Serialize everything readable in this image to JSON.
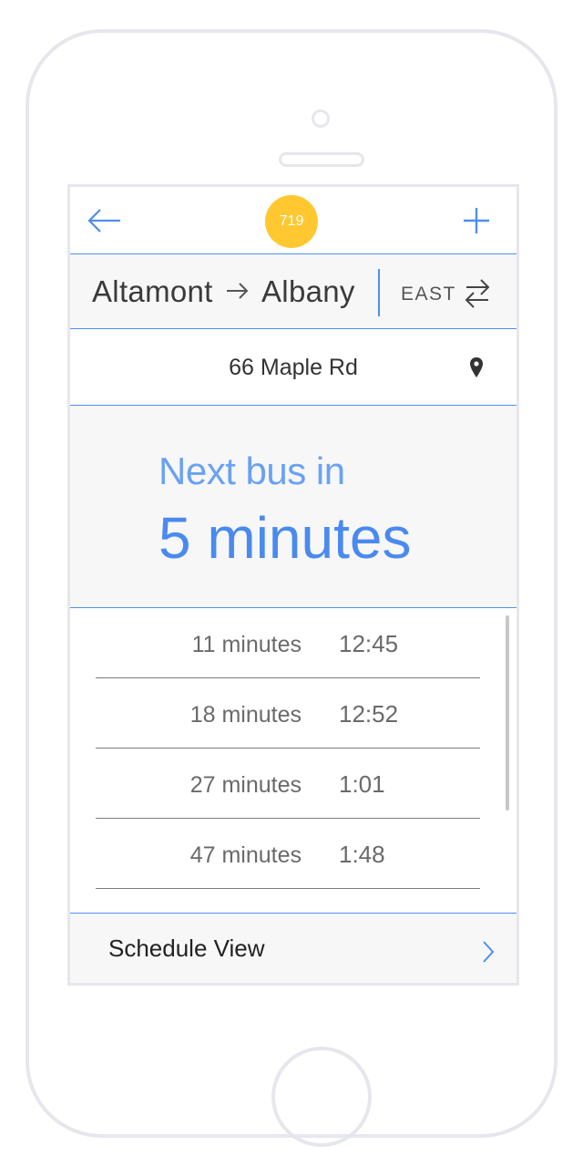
{
  "colors": {
    "accent": "#4f8ef0",
    "badge": "#ffc830",
    "panel_background": "#f7f7f7",
    "device_frame": "#e6e7ed"
  },
  "navbar": {
    "back_icon": "arrow-left-icon",
    "route_number": "719",
    "add_icon": "plus-icon"
  },
  "route": {
    "from": "Altamont",
    "arrow_icon": "arrow-right-icon",
    "to": "Albany",
    "direction": "EAST",
    "swap_icon": "swap-arrows-icon"
  },
  "stop": {
    "name": "66 Maple Rd",
    "icon": "map-pin-icon"
  },
  "next_bus": {
    "label": "Next bus in",
    "value": "5 minutes"
  },
  "arrivals": [
    {
      "wait": "11 minutes",
      "time": "12:45"
    },
    {
      "wait": "18 minutes",
      "time": "12:52"
    },
    {
      "wait": "27 minutes",
      "time": "1:01"
    },
    {
      "wait": "47 minutes",
      "time": "1:48"
    }
  ],
  "schedule": {
    "label": "Schedule View",
    "icon": "chevron-right-icon"
  }
}
